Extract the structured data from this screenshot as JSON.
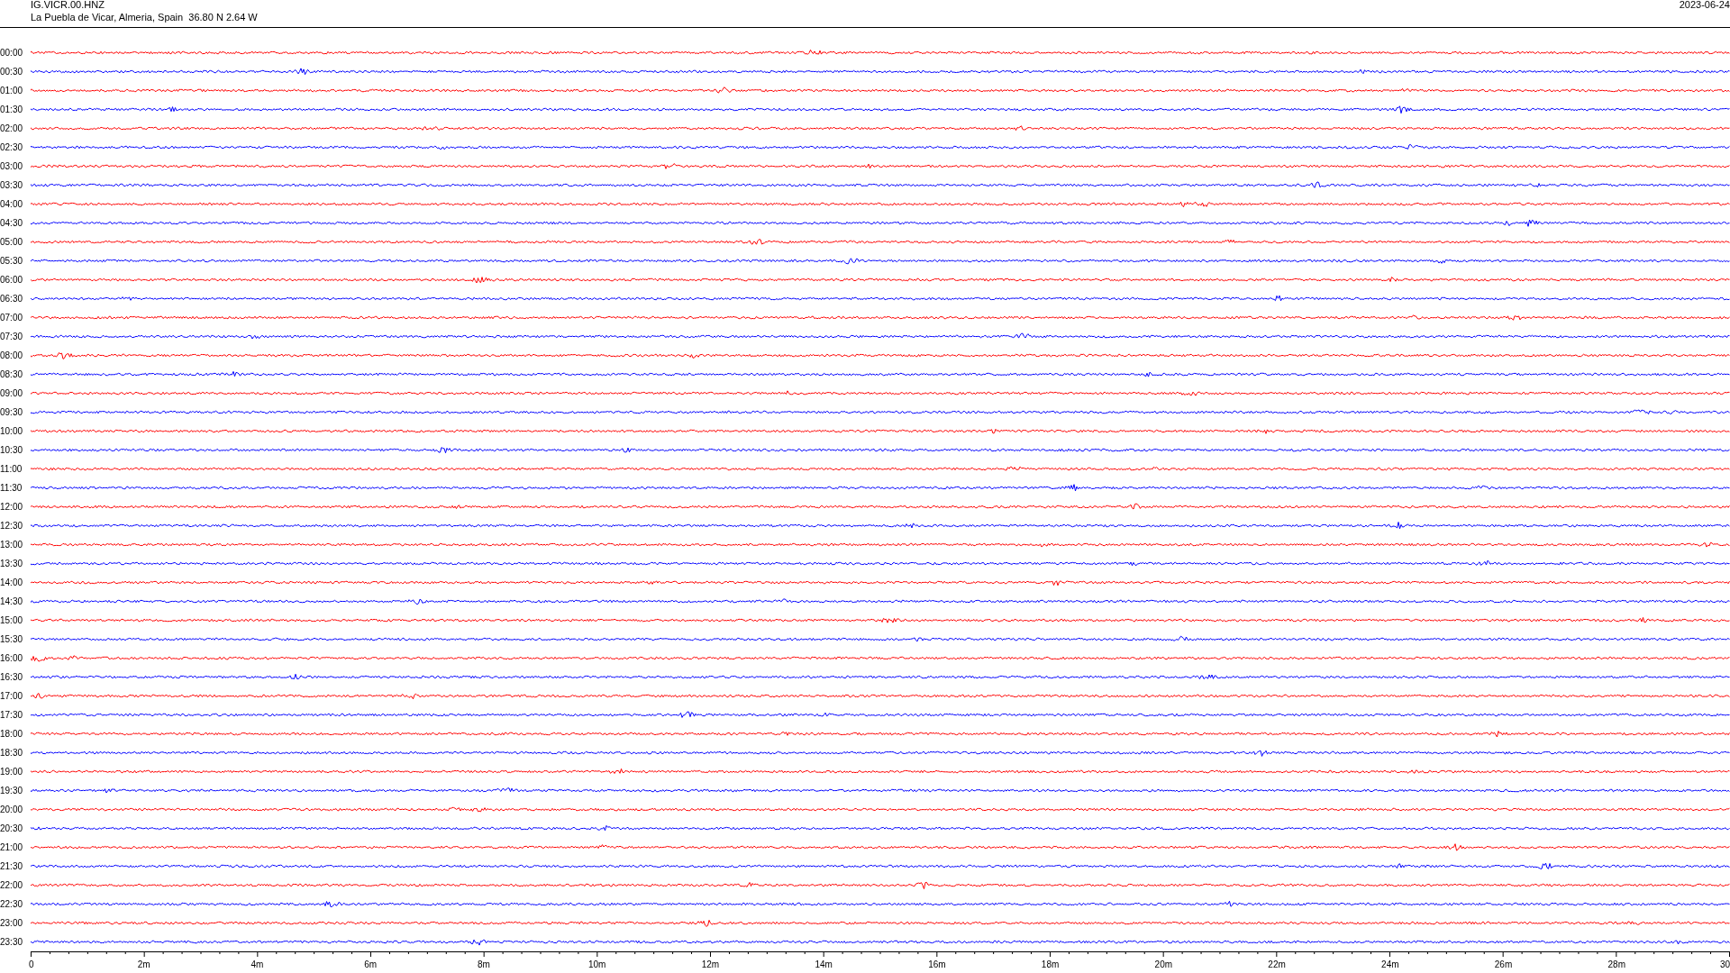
{
  "header": {
    "station": "IG.VICR.00.HNZ",
    "location": "La Puebla de Vicar, Almeria, Spain  36.80 N 2.64 W",
    "date": "2023-06-24"
  },
  "traces": [
    {
      "label": "00:00",
      "color": "#ff0000"
    },
    {
      "label": "00:30",
      "color": "#0000ff"
    },
    {
      "label": "01:00",
      "color": "#ff0000"
    },
    {
      "label": "01:30",
      "color": "#0000ff"
    },
    {
      "label": "02:00",
      "color": "#ff0000"
    },
    {
      "label": "02:30",
      "color": "#0000ff"
    },
    {
      "label": "03:00",
      "color": "#ff0000"
    },
    {
      "label": "03:30",
      "color": "#0000ff"
    },
    {
      "label": "04:00",
      "color": "#ff0000"
    },
    {
      "label": "04:30",
      "color": "#0000ff"
    },
    {
      "label": "05:00",
      "color": "#ff0000"
    },
    {
      "label": "05:30",
      "color": "#0000ff"
    },
    {
      "label": "06:00",
      "color": "#ff0000"
    },
    {
      "label": "06:30",
      "color": "#0000ff"
    },
    {
      "label": "07:00",
      "color": "#ff0000"
    },
    {
      "label": "07:30",
      "color": "#0000ff"
    },
    {
      "label": "08:00",
      "color": "#ff0000"
    },
    {
      "label": "08:30",
      "color": "#0000ff"
    },
    {
      "label": "09:00",
      "color": "#ff0000"
    },
    {
      "label": "09:30",
      "color": "#0000ff"
    },
    {
      "label": "10:00",
      "color": "#ff0000"
    },
    {
      "label": "10:30",
      "color": "#0000ff"
    },
    {
      "label": "11:00",
      "color": "#ff0000"
    },
    {
      "label": "11:30",
      "color": "#0000ff"
    },
    {
      "label": "12:00",
      "color": "#ff0000"
    },
    {
      "label": "12:30",
      "color": "#0000ff"
    },
    {
      "label": "13:00",
      "color": "#ff0000"
    },
    {
      "label": "13:30",
      "color": "#0000ff"
    },
    {
      "label": "14:00",
      "color": "#ff0000"
    },
    {
      "label": "14:30",
      "color": "#0000ff"
    },
    {
      "label": "15:00",
      "color": "#ff0000"
    },
    {
      "label": "15:30",
      "color": "#0000ff"
    },
    {
      "label": "16:00",
      "color": "#ff0000"
    },
    {
      "label": "16:30",
      "color": "#0000ff"
    },
    {
      "label": "17:00",
      "color": "#ff0000"
    },
    {
      "label": "17:30",
      "color": "#0000ff"
    },
    {
      "label": "18:00",
      "color": "#ff0000"
    },
    {
      "label": "18:30",
      "color": "#0000ff"
    },
    {
      "label": "19:00",
      "color": "#ff0000"
    },
    {
      "label": "19:30",
      "color": "#0000ff"
    },
    {
      "label": "20:00",
      "color": "#ff0000"
    },
    {
      "label": "20:30",
      "color": "#0000ff"
    },
    {
      "label": "21:00",
      "color": "#ff0000"
    },
    {
      "label": "21:30",
      "color": "#0000ff"
    },
    {
      "label": "22:00",
      "color": "#ff0000"
    },
    {
      "label": "22:30",
      "color": "#0000ff"
    },
    {
      "label": "23:00",
      "color": "#ff0000"
    },
    {
      "label": "23:30",
      "color": "#0000ff"
    }
  ],
  "time_axis": {
    "ticks": [
      "0",
      "2m",
      "4m",
      "6m",
      "8m",
      "10m",
      "12m",
      "14m",
      "16m",
      "18m",
      "20m",
      "22m",
      "24m",
      "26m",
      "28m",
      "30"
    ]
  }
}
